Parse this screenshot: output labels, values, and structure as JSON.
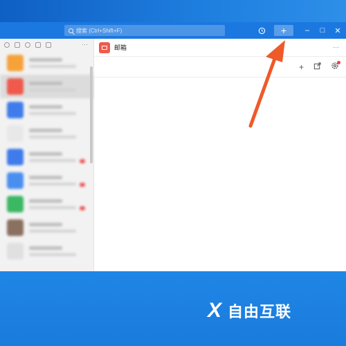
{
  "search": {
    "placeholder": "搜索 (Ctrl+Shift+F)"
  },
  "titlebar": {
    "add_label": "+",
    "minimize_label": "–",
    "maximize_label": "□",
    "close_label": "✕"
  },
  "sidebar": {
    "more_label": "···",
    "tool_icons": [
      "at-icon",
      "star-icon",
      "contacts-icon",
      "doc-icon",
      "file-icon"
    ],
    "items": [
      {
        "color": "#f5a23a"
      },
      {
        "color": "#ef5a4c",
        "selected": true
      },
      {
        "color": "#3f7bea"
      },
      {
        "color": "#e8e8e8"
      },
      {
        "color": "#3f7bea"
      },
      {
        "color": "#4a8ff0"
      },
      {
        "color": "#3cb763"
      },
      {
        "color": "#8a7060"
      },
      {
        "color": "#e0e0e0"
      }
    ]
  },
  "main": {
    "title": "邮箱",
    "more_label": "···",
    "toolbar": {
      "add_label": "+"
    }
  },
  "watermark": {
    "logo": "X",
    "text": "自由互联"
  },
  "colors": {
    "accent": "#1b78e0",
    "arrow": "#ee5a2a",
    "mail": "#ef5a4c"
  }
}
